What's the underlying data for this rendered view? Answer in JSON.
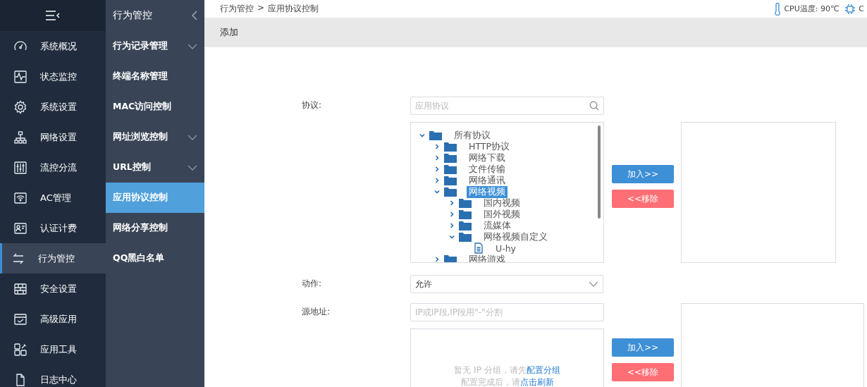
{
  "nav": {
    "items": [
      {
        "label": "系统概况",
        "kind": "gauge",
        "selected": false
      },
      {
        "label": "状态监控",
        "kind": "pulse",
        "selected": false
      },
      {
        "label": "系统设置",
        "kind": "gear",
        "selected": false
      },
      {
        "label": "网络设置",
        "kind": "network",
        "selected": false
      },
      {
        "label": "流控分流",
        "kind": "sliders",
        "selected": false
      },
      {
        "label": "AC管理",
        "kind": "wifi",
        "selected": false
      },
      {
        "label": "认证计费",
        "kind": "idcard",
        "selected": false
      },
      {
        "label": "行为管控",
        "kind": "arrows",
        "selected": true
      },
      {
        "label": "安全设置",
        "kind": "wall",
        "selected": false
      },
      {
        "label": "高级应用",
        "kind": "check",
        "selected": false
      },
      {
        "label": "应用工具",
        "kind": "tools",
        "selected": false
      },
      {
        "label": "日志中心",
        "kind": "docs",
        "selected": false
      }
    ]
  },
  "subnav": {
    "title": "行为管控",
    "items": [
      {
        "label": "行为记录管理",
        "expandable": true,
        "selected": false
      },
      {
        "label": "终端名称管理",
        "expandable": false,
        "selected": false
      },
      {
        "label": "MAC访问控制",
        "expandable": false,
        "selected": false
      },
      {
        "label": "网址浏览控制",
        "expandable": true,
        "selected": false
      },
      {
        "label": "URL控制",
        "expandable": true,
        "selected": false
      },
      {
        "label": "应用协议控制",
        "expandable": false,
        "selected": true
      },
      {
        "label": "网络分享控制",
        "expandable": false,
        "selected": false
      },
      {
        "label": "QQ黑白名单",
        "expandable": false,
        "selected": false
      }
    ]
  },
  "breadcrumb": {
    "items": [
      "行为管控",
      "应用协议控制"
    ],
    "separator": ">"
  },
  "status": [
    {
      "kind": "thermometer",
      "text": "CPU温度: 90℃"
    },
    {
      "kind": "chip",
      "text": "C"
    }
  ],
  "tab": {
    "label": "添加"
  },
  "protocol": {
    "label": "协议:",
    "placeholder": "应用协议",
    "tree": [
      {
        "label": "所有协议",
        "kind": "folder",
        "expanded": true,
        "selected": false,
        "children": [
          {
            "label": "HTTP协议",
            "kind": "folder",
            "expanded": false,
            "selected": false
          },
          {
            "label": "网络下载",
            "kind": "folder",
            "expanded": false,
            "selected": false
          },
          {
            "label": "文件传输",
            "kind": "folder",
            "expanded": false,
            "selected": false
          },
          {
            "label": "网络通讯",
            "kind": "folder",
            "expanded": false,
            "selected": false
          },
          {
            "label": "网络视频",
            "kind": "folder",
            "expanded": true,
            "selected": true,
            "children": [
              {
                "label": "国内视频",
                "kind": "folder",
                "expanded": false,
                "selected": false
              },
              {
                "label": "国外视频",
                "kind": "folder",
                "expanded": false,
                "selected": false
              },
              {
                "label": "流媒体",
                "kind": "folder",
                "expanded": false,
                "selected": false
              },
              {
                "label": "网络视频自定义",
                "kind": "folder",
                "expanded": true,
                "selected": false,
                "children": [
                  {
                    "label": "U-hy",
                    "kind": "file",
                    "selected": false
                  }
                ]
              }
            ]
          },
          {
            "label": "网络游戏",
            "kind": "folder",
            "expanded": false,
            "selected": false
          }
        ]
      }
    ],
    "add_button": "加入>>",
    "remove_button": "<<移除"
  },
  "action": {
    "label": "动作:",
    "value": "允许"
  },
  "source": {
    "label": "源地址:",
    "placeholder": "IP或IP段,IP段用\"-\"分割",
    "empty_text": "暂无 IP 分组，请先",
    "empty_link": "配置分组",
    "hint_text": "配置完成后，请",
    "hint_link": "点击刷新",
    "add_button": "加入>>",
    "remove_button": "<<移除"
  }
}
